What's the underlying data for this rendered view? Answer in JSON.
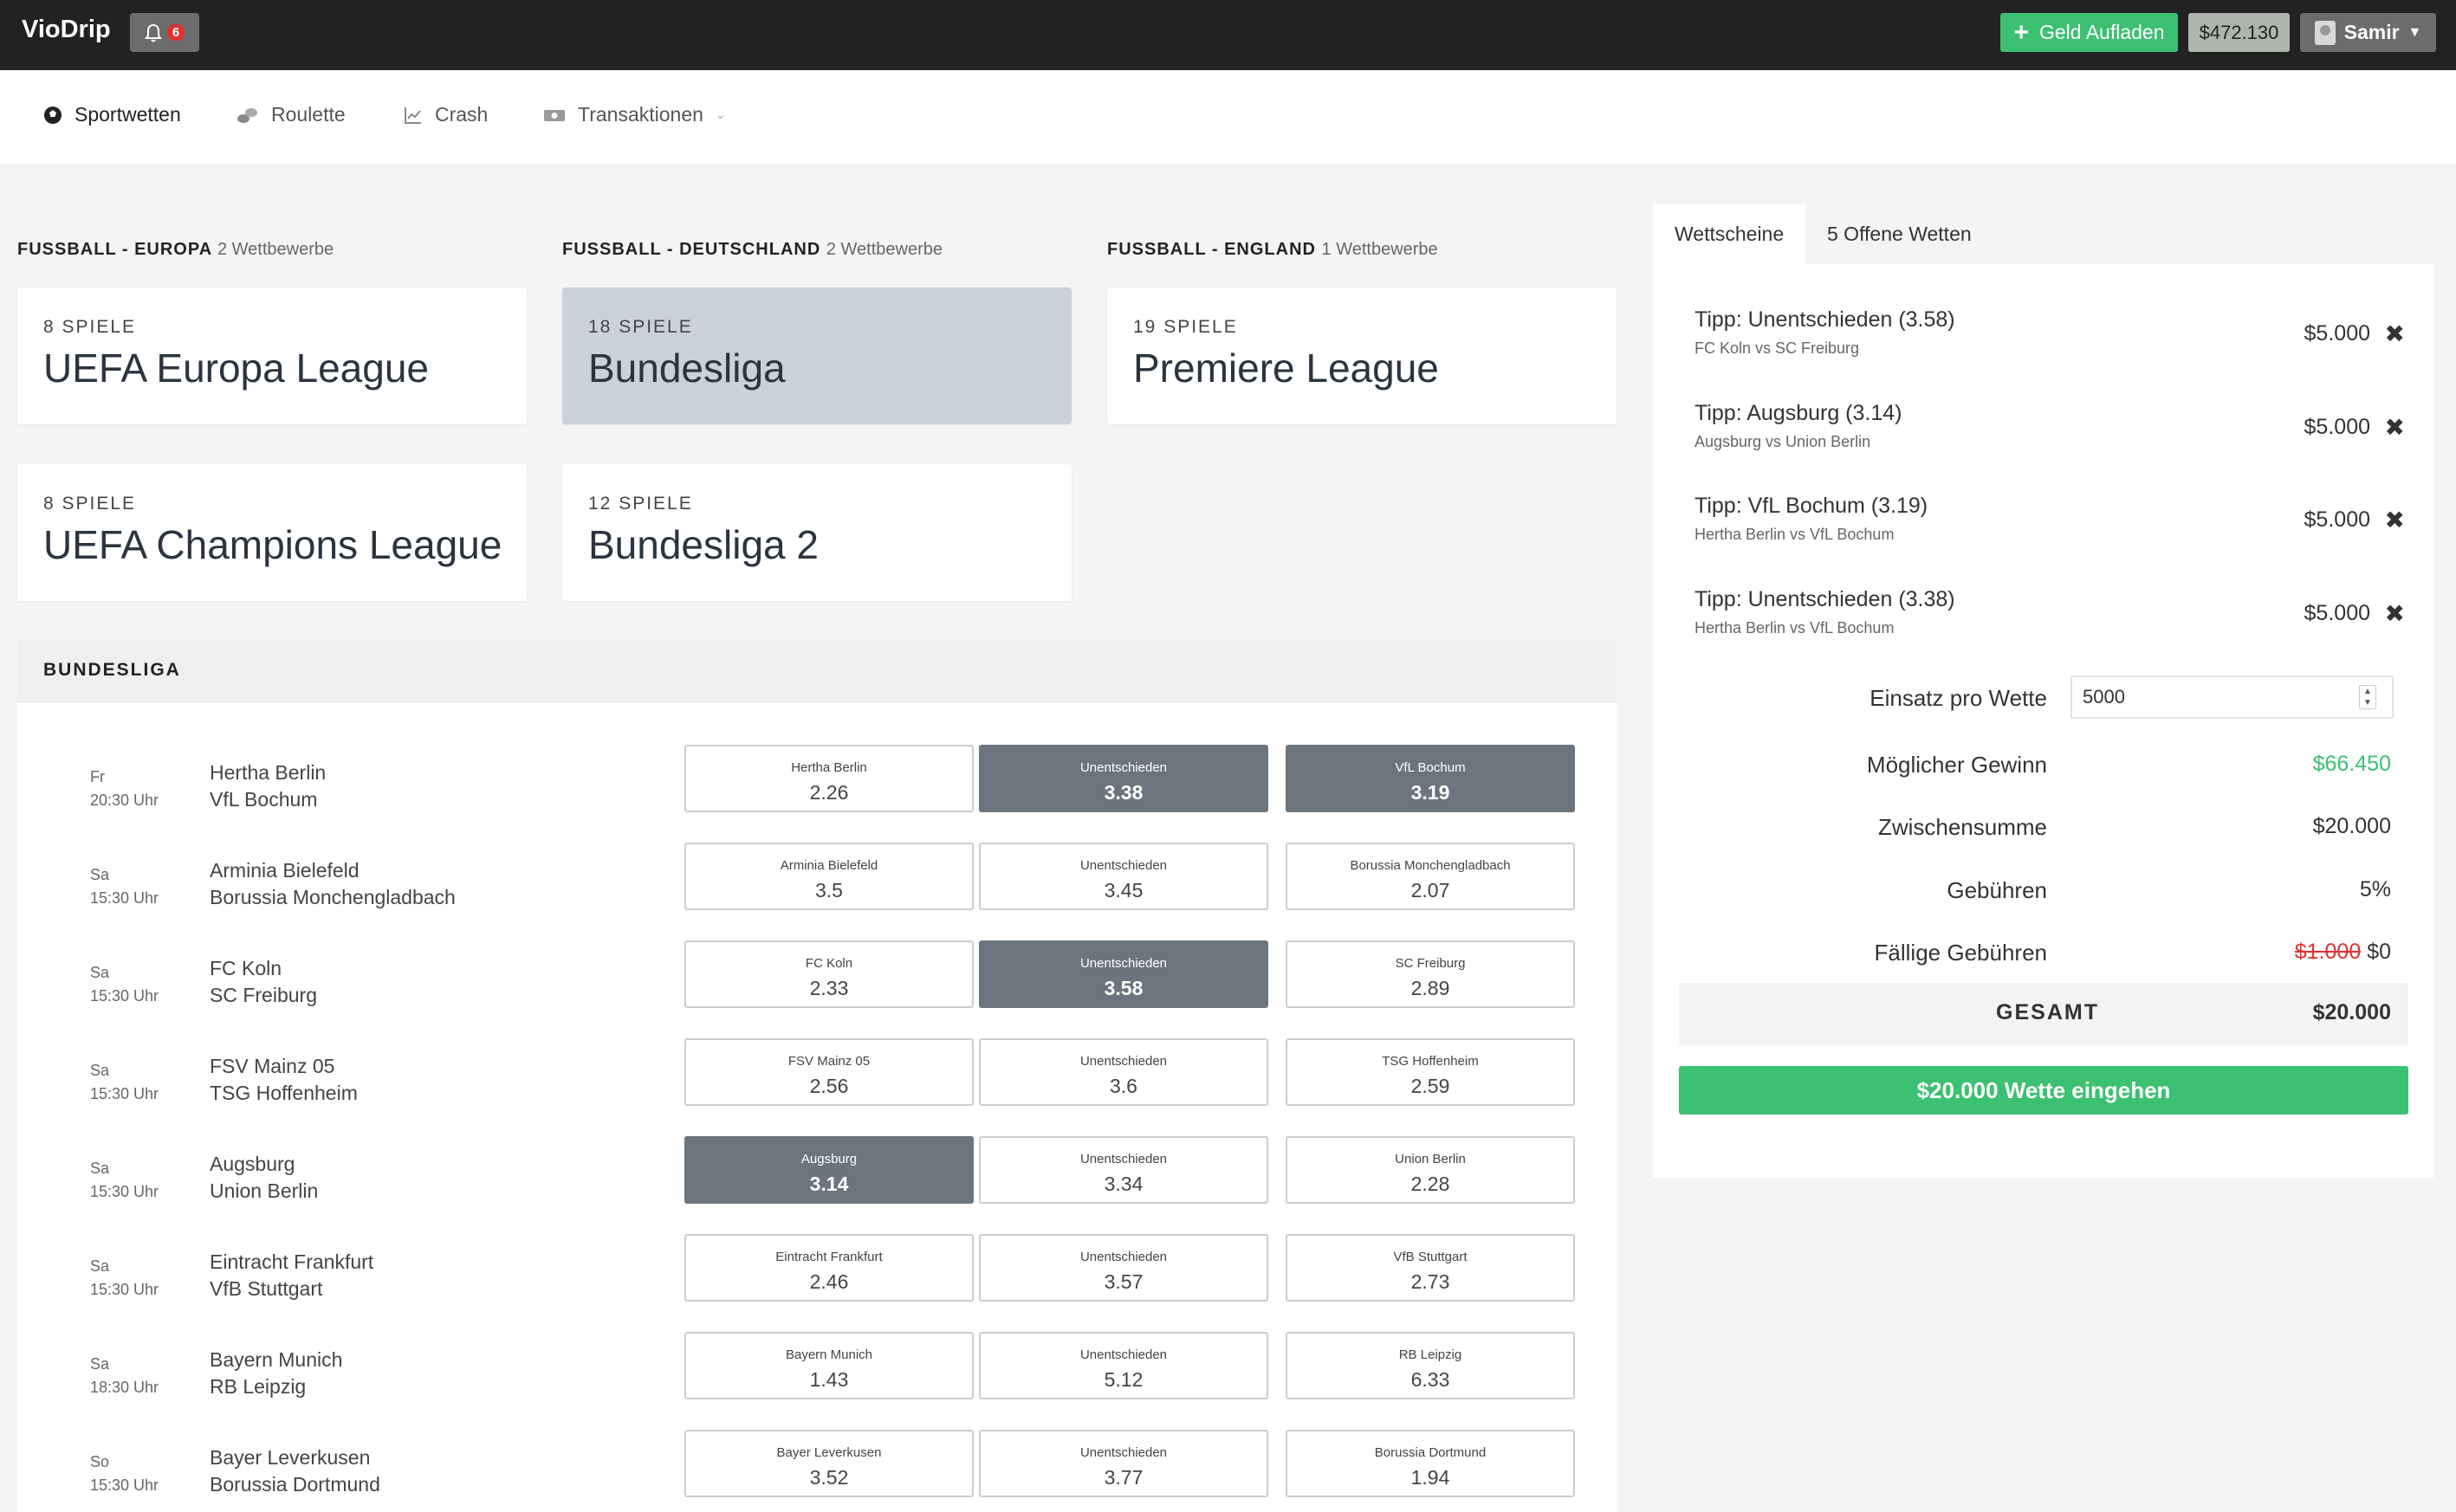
{
  "header": {
    "brand": "VioDrip",
    "notifications_count": "6",
    "add_money_label": "Geld Aufladen",
    "balance": "$472.130",
    "user_name": "Samir"
  },
  "nav": {
    "items": [
      {
        "label": "Sportwetten",
        "icon": "soccer-ball-icon"
      },
      {
        "label": "Roulette",
        "icon": "chips-icon"
      },
      {
        "label": "Crash",
        "icon": "chart-icon"
      },
      {
        "label": "Transaktionen",
        "icon": "money-icon"
      }
    ]
  },
  "groups": [
    {
      "title": "FUSSBALL - EUROPA",
      "sub": "2 Wettbewerbe"
    },
    {
      "title": "FUSSBALL - DEUTSCHLAND",
      "sub": "2 Wettbewerbe"
    },
    {
      "title": "FUSSBALL - ENGLAND",
      "sub": "1 Wettbewerbe"
    }
  ],
  "leagues": [
    {
      "count": "8 SPIELE",
      "name": "UEFA Europa League"
    },
    {
      "count": "18 SPIELE",
      "name": "Bundesliga"
    },
    {
      "count": "19 SPIELE",
      "name": "Premiere League"
    },
    {
      "count": "8 SPIELE",
      "name": "UEFA Champions League"
    },
    {
      "count": "12 SPIELE",
      "name": "Bundesliga 2"
    }
  ],
  "selected_league_header": "BUNDESLIGA",
  "matches": [
    {
      "day": "Fr",
      "time": "20:30 Uhr",
      "home": "Hertha Berlin",
      "away": "VfL Bochum",
      "odds": [
        {
          "label": "Hertha Berlin",
          "value": "2.26"
        },
        {
          "label": "Unentschieden",
          "value": "3.38"
        },
        {
          "label": "VfL Bochum",
          "value": "3.19"
        }
      ]
    },
    {
      "day": "Sa",
      "time": "15:30 Uhr",
      "home": "Arminia Bielefeld",
      "away": "Borussia Monchengladbach",
      "odds": [
        {
          "label": "Arminia Bielefeld",
          "value": "3.5"
        },
        {
          "label": "Unentschieden",
          "value": "3.45"
        },
        {
          "label": "Borussia Monchengladbach",
          "value": "2.07"
        }
      ]
    },
    {
      "day": "Sa",
      "time": "15:30 Uhr",
      "home": "FC Koln",
      "away": "SC Freiburg",
      "odds": [
        {
          "label": "FC Koln",
          "value": "2.33"
        },
        {
          "label": "Unentschieden",
          "value": "3.58"
        },
        {
          "label": "SC Freiburg",
          "value": "2.89"
        }
      ]
    },
    {
      "day": "Sa",
      "time": "15:30 Uhr",
      "home": "FSV Mainz 05",
      "away": "TSG Hoffenheim",
      "odds": [
        {
          "label": "FSV Mainz 05",
          "value": "2.56"
        },
        {
          "label": "Unentschieden",
          "value": "3.6"
        },
        {
          "label": "TSG Hoffenheim",
          "value": "2.59"
        }
      ]
    },
    {
      "day": "Sa",
      "time": "15:30 Uhr",
      "home": "Augsburg",
      "away": "Union Berlin",
      "odds": [
        {
          "label": "Augsburg",
          "value": "3.14"
        },
        {
          "label": "Unentschieden",
          "value": "3.34"
        },
        {
          "label": "Union Berlin",
          "value": "2.28"
        }
      ]
    },
    {
      "day": "Sa",
      "time": "15:30 Uhr",
      "home": "Eintracht Frankfurt",
      "away": "VfB Stuttgart",
      "odds": [
        {
          "label": "Eintracht Frankfurt",
          "value": "2.46"
        },
        {
          "label": "Unentschieden",
          "value": "3.57"
        },
        {
          "label": "VfB Stuttgart",
          "value": "2.73"
        }
      ]
    },
    {
      "day": "Sa",
      "time": "18:30 Uhr",
      "home": "Bayern Munich",
      "away": "RB Leipzig",
      "odds": [
        {
          "label": "Bayern Munich",
          "value": "1.43"
        },
        {
          "label": "Unentschieden",
          "value": "5.12"
        },
        {
          "label": "RB Leipzig",
          "value": "6.33"
        }
      ]
    },
    {
      "day": "So",
      "time": "15:30 Uhr",
      "home": "Bayer Leverkusen",
      "away": "Borussia Dortmund",
      "odds": [
        {
          "label": "Bayer Leverkusen",
          "value": "3.52"
        },
        {
          "label": "Unentschieden",
          "value": "3.77"
        },
        {
          "label": "Borussia Dortmund",
          "value": "1.94"
        }
      ]
    }
  ],
  "slip": {
    "tab_slips": "Wettscheine",
    "tab_open": "5 Offene Wetten",
    "tips": [
      {
        "title": "Tipp: Unentschieden (3.58)",
        "match": "FC Koln vs SC Freiburg",
        "amount": "$5.000"
      },
      {
        "title": "Tipp: Augsburg (3.14)",
        "match": "Augsburg vs Union Berlin",
        "amount": "$5.000"
      },
      {
        "title": "Tipp: VfL Bochum (3.19)",
        "match": "Hertha Berlin vs VfL Bochum",
        "amount": "$5.000"
      },
      {
        "title": "Tipp: Unentschieden (3.38)",
        "match": "Hertha Berlin vs VfL Bochum",
        "amount": "$5.000"
      }
    ],
    "stake_label": "Einsatz pro Wette",
    "stake_value": "5000",
    "win_label": "Möglicher Gewinn",
    "win_value": "$66.450",
    "subtotal_label": "Zwischensumme",
    "subtotal_value": "$20.000",
    "fees_label": "Gebühren",
    "fees_value": "5%",
    "due_fees_label": "Fällige Gebühren",
    "due_fees_old": "$1.000",
    "due_fees_value": "$0",
    "total_label": "GESAMT",
    "total_value": "$20.000",
    "place_label": "$20.000 Wette eingehen"
  },
  "colors": {
    "topbar": "#222222",
    "accent_green": "#3cc071",
    "selected_odd": "#6c757d",
    "selected_card": "#cbd1d8"
  }
}
